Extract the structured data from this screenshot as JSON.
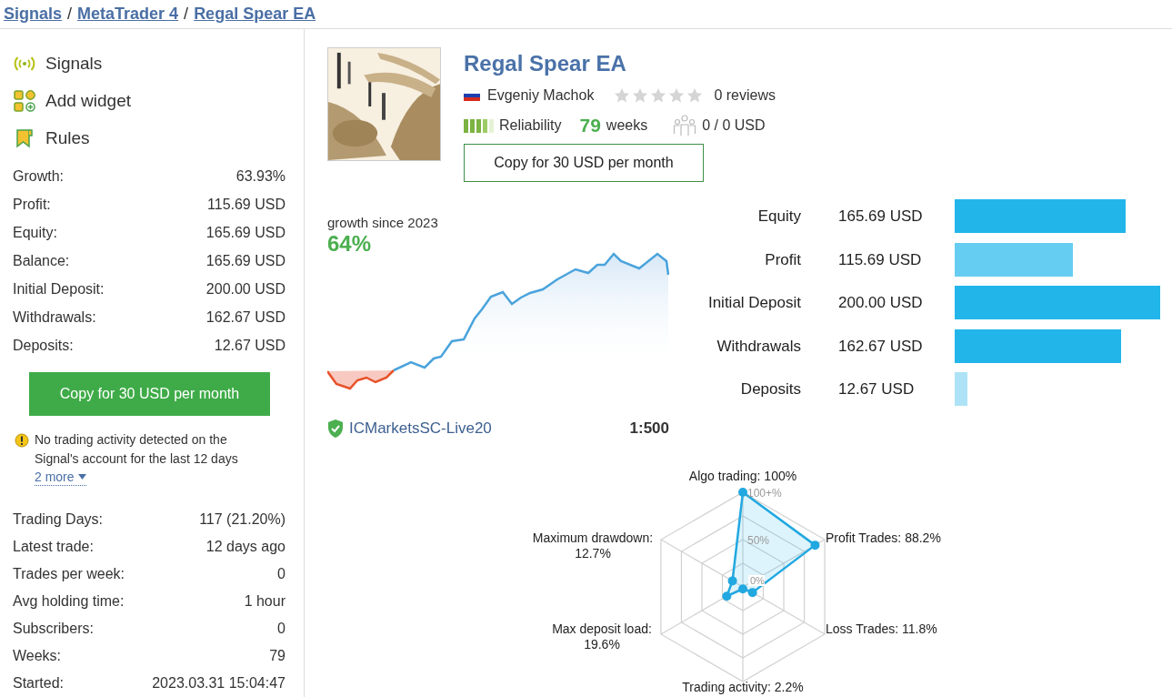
{
  "breadcrumb": {
    "separator": "/",
    "links": [
      "Signals",
      "MetaTrader 4",
      "Regal Spear EA"
    ]
  },
  "sidebar": {
    "nav": [
      {
        "kind": "signal",
        "label": "Signals"
      },
      {
        "kind": "widget",
        "label": "Add widget"
      },
      {
        "kind": "rules",
        "label": "Rules"
      }
    ],
    "stats": [
      {
        "label": "Growth:",
        "value": "63.93%"
      },
      {
        "label": "Profit:",
        "value": "115.69 USD"
      },
      {
        "label": "Equity:",
        "value": "165.69 USD"
      },
      {
        "label": "Balance:",
        "value": "165.69 USD"
      },
      {
        "label": "Initial Deposit:",
        "value": "200.00 USD"
      },
      {
        "label": "Withdrawals:",
        "value": "162.67 USD"
      },
      {
        "label": "Deposits:",
        "value": "12.67 USD"
      }
    ],
    "copy_button": "Copy for 30 USD per month",
    "notice": {
      "text": "No trading activity detected on the Signal's account for the last 12 days",
      "more": "2 more"
    },
    "stats_2": [
      {
        "label": "Trading Days:",
        "value": "117 (21.20%)"
      },
      {
        "label": "Latest trade:",
        "value": "12 days ago"
      },
      {
        "label": "Trades per week:",
        "value": "0"
      },
      {
        "label": "Avg holding time:",
        "value": "1 hour"
      },
      {
        "label": "Subscribers:",
        "value": "0"
      },
      {
        "label": "Weeks:",
        "value": "79"
      },
      {
        "label": "Started:",
        "value": "2023.03.31 15:04:47"
      }
    ]
  },
  "signal": {
    "title": "Regal Spear EA",
    "author": "Evgeniy Machok",
    "stars": 0,
    "reviews": "0 reviews",
    "reliability": {
      "label": "Reliability",
      "level": 0.8
    },
    "weeks_value": "79",
    "weeks_label": "weeks",
    "subscribers": "0 / 0 USD",
    "copy_button": "Copy for 30 USD per month"
  },
  "growth": {
    "caption": "growth since 2023",
    "value": "64%",
    "broker": "ICMarketsSC-Live20",
    "leverage": "1:500"
  },
  "balance_bars": [
    {
      "label": "Equity",
      "value": "165.69 USD",
      "color": "#22b5ea"
    },
    {
      "label": "Profit",
      "value": "115.69 USD",
      "color": "#66cdf2"
    },
    {
      "label": "Initial Deposit",
      "value": "200.00 USD",
      "color": "#22b5ea"
    },
    {
      "label": "Withdrawals",
      "value": "162.67 USD",
      "color": "#22b5ea"
    },
    {
      "label": "Deposits",
      "value": "12.67 USD",
      "color": "#aee3f7"
    }
  ],
  "risk_radar": {
    "ticks": [
      "100+%",
      "50%",
      "0%"
    ],
    "axes": [
      {
        "label": "Algo trading:",
        "value": "100%"
      },
      {
        "label": "Maximum drawdown:",
        "value": "12.7%"
      },
      {
        "label": "Profit Trades:",
        "value": "88.2%"
      },
      {
        "label": "Max deposit load:",
        "value": "19.6%"
      },
      {
        "label": "Loss Trades:",
        "value": "11.8%"
      },
      {
        "label": "Trading activity:",
        "value": "2.2%"
      }
    ]
  }
}
